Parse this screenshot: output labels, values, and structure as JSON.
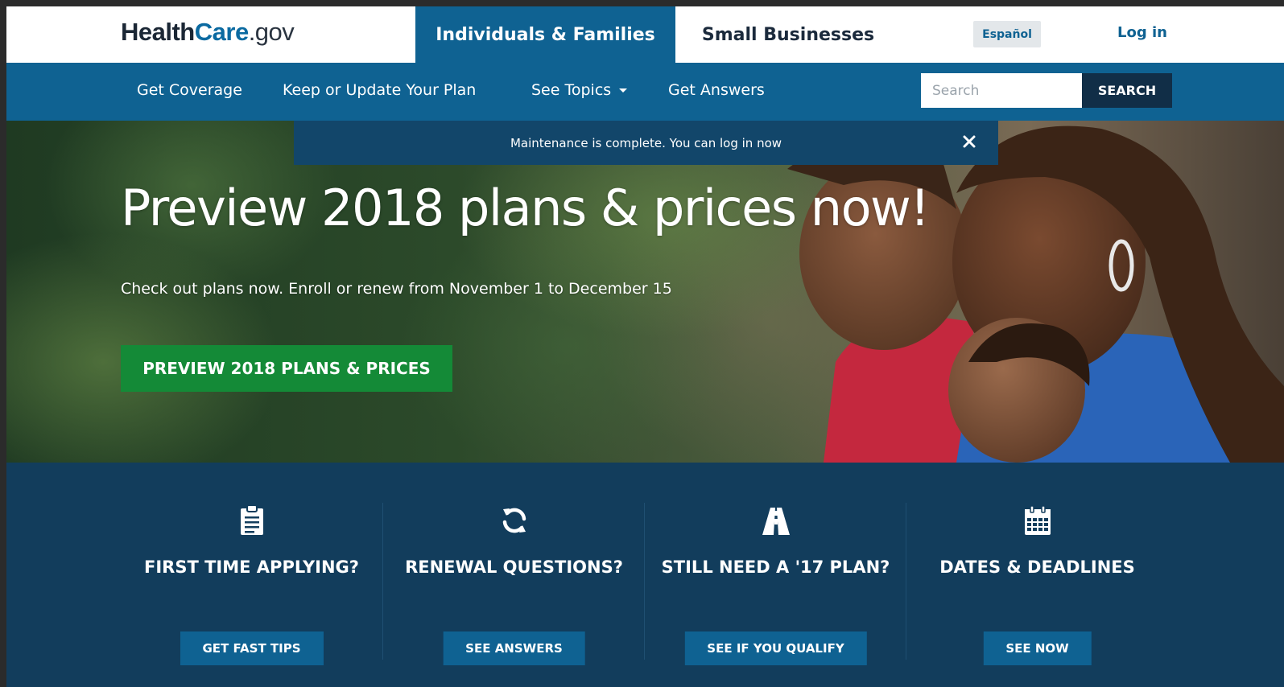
{
  "header": {
    "logo": {
      "part1": "Health",
      "part2": "Care",
      "part3": ".gov"
    },
    "tabs": [
      {
        "label": "Individuals & Families",
        "active": true
      },
      {
        "label": "Small Businesses",
        "active": false
      }
    ],
    "language_button": "Español",
    "login_link": "Log in"
  },
  "nav": {
    "items": [
      {
        "label": "Get Coverage"
      },
      {
        "label": "Keep or Update Your Plan"
      },
      {
        "label": "See Topics",
        "has_dropdown": true
      },
      {
        "label": "Get Answers"
      }
    ],
    "search": {
      "placeholder": "Search",
      "value": "",
      "button_label": "SEARCH"
    }
  },
  "alert": {
    "message": "Maintenance is complete. You can log in now",
    "close_icon": "close-icon"
  },
  "hero": {
    "title": "Preview 2018 plans & prices now!",
    "subtitle": "Check out plans now. Enroll or renew from November 1 to December 15",
    "cta_label": "PREVIEW 2018 PLANS & PRICES"
  },
  "panels": [
    {
      "icon": "clipboard-icon",
      "title": "FIRST TIME APPLYING?",
      "button_label": "GET FAST TIPS"
    },
    {
      "icon": "refresh-icon",
      "title": "RENEWAL QUESTIONS?",
      "button_label": "SEE ANSWERS"
    },
    {
      "icon": "road-icon",
      "title": "STILL NEED A '17 PLAN?",
      "button_label": "SEE IF YOU QUALIFY"
    },
    {
      "icon": "calendar-icon",
      "title": "DATES & DEADLINES",
      "button_label": "SEE NOW"
    }
  ],
  "colors": {
    "brand_blue": "#0f6292",
    "nav_dark": "#112e47",
    "panel_bg": "#123d5c",
    "alert_bg": "#12466a",
    "cta_green": "#148a37"
  }
}
